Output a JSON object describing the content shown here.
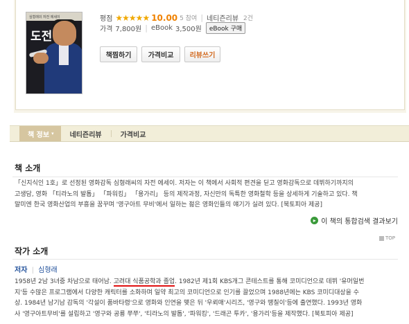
{
  "book": {
    "cover_title": "도전",
    "cover_subtitle": "심형래의 자전 에세이",
    "rating_label": "평점",
    "stars": "★★★★★",
    "score": "10.00",
    "rating_count": "5 참여",
    "netizen_review_label": "네티즌리뷰",
    "netizen_review_count": "2건",
    "price_label": "가격",
    "price": "7,800원",
    "ebook_label": "eBook",
    "ebook_price": "3,500원",
    "ebook_buy_button": "eBook 구매"
  },
  "actions": {
    "bookmark": "책찜하기",
    "compare": "가격비교",
    "write_review": "리뷰쓰기"
  },
  "tabs": [
    {
      "label": "책 정보",
      "caret": "▾"
    },
    {
      "label": "네티즌리뷰"
    },
    {
      "label": "가격비교"
    }
  ],
  "intro": {
    "title": "책 소개",
    "lines": [
      "「신지식인 1호」로 선정된 영화감독 심형래씨의 자전 에세이. 저자는 이 책에서 사회적 편견을 딛고 영화감독으로 데뷔하기까지의",
      "고생담, 영화 「티라노의 발톱」 「파워킹」 「용가리」 등의 제작과정, 자신만의 독특한 영화철학 등을 상세하게 기술하고 있다. 책",
      "말미엔 한국 영화산업의 부흥을 꿈꾸며 '영구아트 무비'에서 일하는 젊은 영화인들의 얘기가 실려 있다. [북토피아 제공]"
    ],
    "more_link": "이 책의 통합검색 결과보기"
  },
  "top_link": "TOP",
  "author": {
    "title": "작가 소개",
    "role": "저자",
    "name": "심형래",
    "line1_before": "1958년 2남 3녀중 차남으로 태어남. ",
    "line1_highlight": "고려대 식품공학과 졸업",
    "line1_after": ". 1982년 제1회 KBS개그 콘테스트를 통해 코미디언으로 데뷔 '유머일번",
    "line2": "지'등 수많은 프로그램에서 다양한 캐릭터를 소화하며 일약 최고의 코미디언으로 인기를 끌었으며 1988년에는 KBS 코미디대상을 수",
    "line3": "상. 1984년 남기남 감독의 '각설이 품바타령'으로 영화와 인연을 맺은 뒤 '우뢰매'시리즈, '영구와 땡칠이'등에 출연했다. 1993년 영화",
    "line4": "사 '영구아트무비'를 설립하고 '영구와 공룡 쭈쭈', '티라노의 발톱', '파워킹', '드래곤 투카', '용가리'등을 제작했다. [북토피아 제공]"
  }
}
